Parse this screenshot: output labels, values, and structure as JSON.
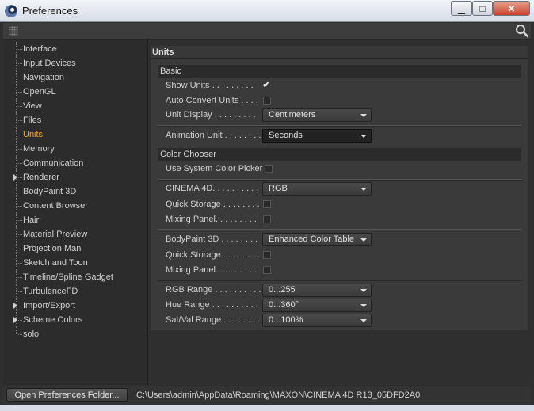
{
  "window": {
    "title": "Preferences",
    "minimize_glyph": "▁",
    "maximize_glyph": "□",
    "close_glyph": "✕"
  },
  "sidebar": {
    "items": [
      {
        "label": "Interface"
      },
      {
        "label": "Input Devices"
      },
      {
        "label": "Navigation"
      },
      {
        "label": "OpenGL"
      },
      {
        "label": "View"
      },
      {
        "label": "Files"
      },
      {
        "label": "Units",
        "active": true
      },
      {
        "label": "Memory"
      },
      {
        "label": "Communication"
      },
      {
        "label": "Renderer",
        "expandable": true
      },
      {
        "label": "BodyPaint 3D"
      },
      {
        "label": "Content Browser"
      },
      {
        "label": "Hair"
      },
      {
        "label": "Material Preview"
      },
      {
        "label": "Projection Man"
      },
      {
        "label": "Sketch and Toon"
      },
      {
        "label": "Timeline/Spline Gadget"
      },
      {
        "label": "TurbulenceFD"
      },
      {
        "label": "Import/Export",
        "expandable": true
      },
      {
        "label": "Scheme Colors",
        "expandable": true
      },
      {
        "label": "solo"
      }
    ]
  },
  "panel": {
    "title": "Units",
    "basic": {
      "heading": "Basic",
      "show_units": {
        "label": "Show Units . . . . . . . . .",
        "checked": true
      },
      "auto_convert": {
        "label": "Auto Convert Units . . . .",
        "checked": false
      },
      "unit_display": {
        "label": "Unit Display . . . . . . . . .",
        "value": "Centimeters"
      },
      "animation_unit": {
        "label": "Animation Unit . . . . . . . .",
        "value": "Seconds"
      }
    },
    "color_chooser": {
      "heading": "Color Chooser",
      "use_system": {
        "label": "Use System Color Picker",
        "checked": false
      },
      "cinema4d": {
        "label": "CINEMA 4D. . . . . . . . . . .",
        "value": "RGB"
      },
      "quick_storage_1": {
        "label": "Quick Storage . . . . . . . .",
        "checked": false
      },
      "mixing_panel_1": {
        "label": "Mixing Panel. . . . . . . . .",
        "checked": false
      },
      "bodypaint": {
        "label": "BodyPaint 3D . . . . . . . . .",
        "value": "Enhanced Color Table"
      },
      "quick_storage_2": {
        "label": "Quick Storage . . . . . . . .",
        "checked": false
      },
      "mixing_panel_2": {
        "label": "Mixing Panel. . . . . . . . .",
        "checked": false
      },
      "rgb_range": {
        "label": "RGB Range . . . . . . . . . .",
        "value": "0...255"
      },
      "hue_range": {
        "label": "Hue Range . . . . . . . . . . .",
        "value": "0...360°"
      },
      "satval_range": {
        "label": "Sat/Val Range . . . . . . . .",
        "value": "0...100%"
      }
    }
  },
  "footer": {
    "open_button": "Open Preferences Folder...",
    "path": "C:\\Users\\admin\\AppData\\Roaming\\MAXON\\CINEMA 4D R13_05DFD2A0"
  },
  "icons": {
    "app": "cinema4d-logo-icon",
    "grip": "grip-icon",
    "search": "search-icon"
  },
  "colors": {
    "active_item": "#f3a733",
    "background": "#2f2f2f",
    "group": "#3a3a3a"
  }
}
